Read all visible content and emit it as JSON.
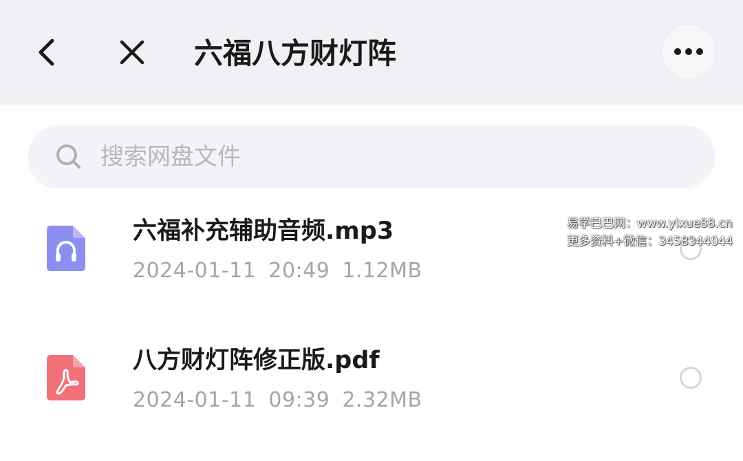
{
  "header": {
    "title": "六福八方财灯阵",
    "back_icon": "chevron-left-icon",
    "close_icon": "close-icon",
    "more_icon": "more-dots-icon"
  },
  "search": {
    "placeholder": "搜索网盘文件",
    "value": ""
  },
  "files": [
    {
      "name": "六福补充辅助音频.mp3",
      "date": "2024-01-11",
      "time": "20:49",
      "size": "1.12MB",
      "icon": "audio-file-icon",
      "color": "#8c8ef0"
    },
    {
      "name": "八方财灯阵修正版.pdf",
      "date": "2024-01-11",
      "time": "09:39",
      "size": "2.32MB",
      "icon": "pdf-file-icon",
      "color": "#f07177"
    }
  ],
  "watermark": {
    "line1": "易学巴巴网：www.yixue88.cn",
    "line2": "更多资料+微信：3458344044"
  }
}
